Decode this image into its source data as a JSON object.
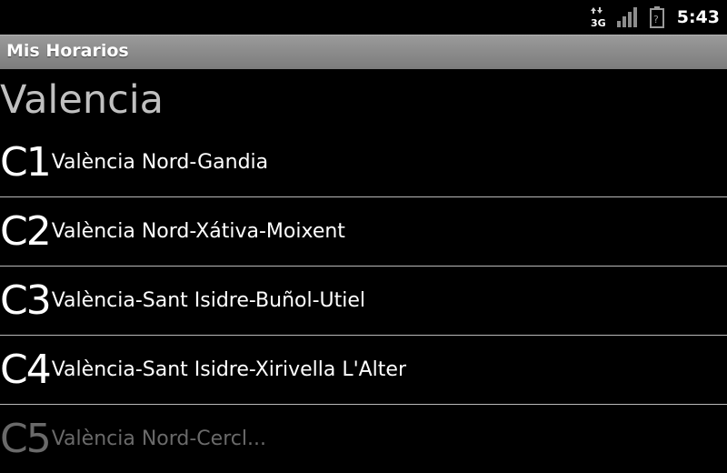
{
  "status_bar": {
    "network": "3G",
    "time": "5:43",
    "icons": [
      "network-3g-icon",
      "signal-strength-icon",
      "battery-unknown-icon"
    ],
    "battery_glyph": "?"
  },
  "app": {
    "title": "Mis Horarios"
  },
  "heading": "Valencia",
  "routes": [
    {
      "code": "C1",
      "name": "València Nord-Gandia"
    },
    {
      "code": "C2",
      "name": "València Nord-Xátiva-Moixent"
    },
    {
      "code": "C3",
      "name": "València-Sant Isidre-Buñol-Utiel"
    },
    {
      "code": "C4",
      "name": "València-Sant Isidre-Xirivella L'Alter"
    },
    {
      "code": "C5",
      "name": "València Nord-Cercl..."
    }
  ],
  "colors": {
    "background": "#000000",
    "title_bar": "#8a8a8a",
    "heading_text": "#c0c0c0",
    "divider": "#b8b8b8"
  }
}
